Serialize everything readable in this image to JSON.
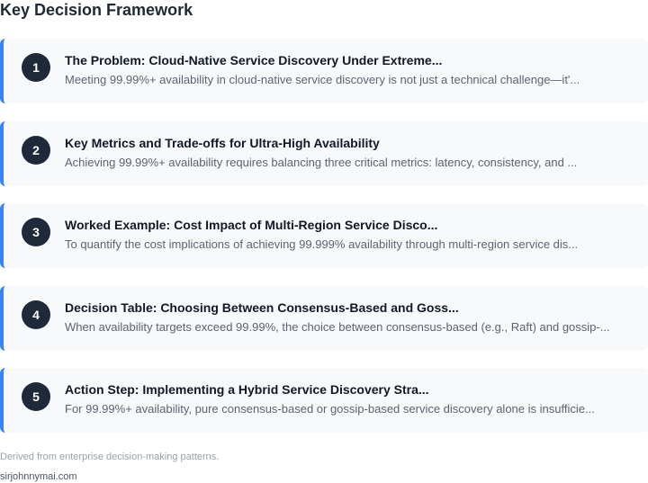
{
  "title": "Key Decision Framework",
  "items": [
    {
      "number": "1",
      "heading": "The Problem: Cloud-Native Service Discovery Under Extreme...",
      "description": "Meeting 99.99%+ availability in cloud-native service discovery is not just a technical challenge—it'..."
    },
    {
      "number": "2",
      "heading": "Key Metrics and Trade-offs for Ultra-High Availability",
      "description": "Achieving 99.99%+ availability requires balancing three critical metrics: latency, consistency, and ..."
    },
    {
      "number": "3",
      "heading": "Worked Example: Cost Impact of Multi-Region Service Disco...",
      "description": "To quantify the cost implications of achieving 99.999% availability through multi-region service dis..."
    },
    {
      "number": "4",
      "heading": "Decision Table: Choosing Between Consensus-Based and Goss...",
      "description": "When availability targets exceed 99.99%, the choice between consensus-based (e.g., Raft) and gossip-..."
    },
    {
      "number": "5",
      "heading": "Action Step: Implementing a Hybrid Service Discovery Stra...",
      "description": "For 99.99%+ availability, pure consensus-based or gossip-based service discovery alone is insufficie..."
    }
  ],
  "footnote": "Derived from enterprise decision-making patterns.",
  "site": "sirjohnnymai.com",
  "colors": {
    "accent": "#3b82f6",
    "badge": "#1e2939",
    "card_bg": "#f8f9fb"
  }
}
